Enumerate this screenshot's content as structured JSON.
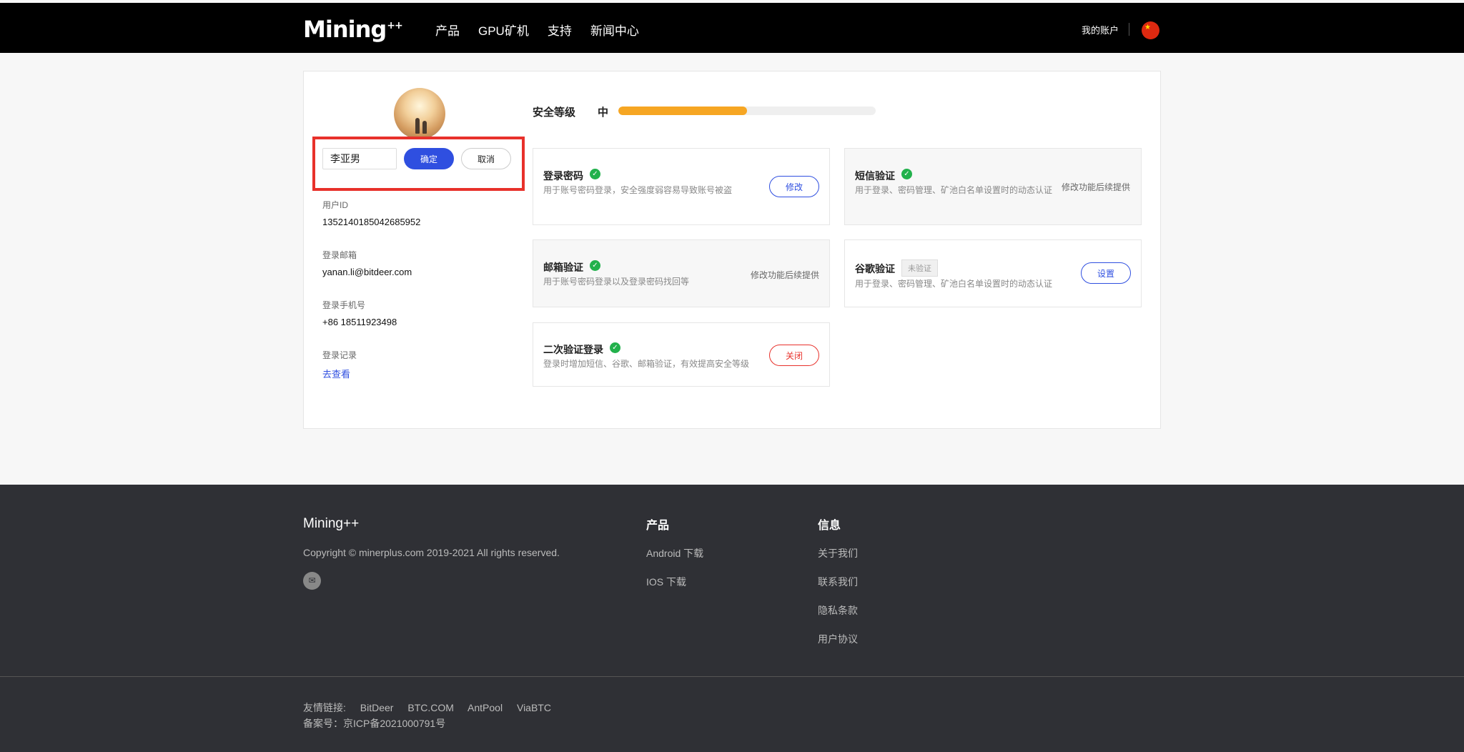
{
  "header": {
    "logo": "Mining",
    "logo_sup": "++",
    "nav": [
      "产品",
      "GPU矿机",
      "支持",
      "新闻中心"
    ],
    "account": "我的账户"
  },
  "profile": {
    "name_value": "李亚男",
    "confirm_label": "确定",
    "cancel_label": "取消",
    "user_id_label": "用户ID",
    "user_id": "1352140185042685952",
    "email_label": "登录邮箱",
    "email": "yanan.li@bitdeer.com",
    "phone_label": "登录手机号",
    "phone": "+86 18511923498",
    "log_label": "登录记录",
    "log_link": "去查看"
  },
  "security": {
    "title": "安全等级",
    "level": "中",
    "progress": 0.5,
    "panels": {
      "password": {
        "title": "登录密码",
        "desc": "用于账号密码登录，安全强度弱容易导致账号被盗",
        "button": "修改"
      },
      "sms": {
        "title": "短信验证",
        "desc": "用于登录、密码管理、矿池白名单设置时的动态认证",
        "note": "修改功能后续提供"
      },
      "email": {
        "title": "邮箱验证",
        "desc": "用于账号密码登录以及登录密码找回等",
        "note": "修改功能后续提供"
      },
      "google": {
        "title": "谷歌验证",
        "tag": "未验证",
        "desc": "用于登录、密码管理、矿池白名单设置时的动态认证",
        "button": "设置"
      },
      "twofa": {
        "title": "二次验证登录",
        "desc": "登录时增加短信、谷歌、邮箱验证，有效提高安全等级",
        "button": "关闭"
      }
    }
  },
  "footer": {
    "brand": "Mining++",
    "copyright": "Copyright © minerplus.com 2019-2021 All rights reserved.",
    "products_head": "产品",
    "products": [
      "Android 下载",
      "IOS 下载"
    ],
    "info_head": "信息",
    "info": [
      "关于我们",
      "联系我们",
      "隐私条款",
      "用户协议"
    ],
    "friends_label": "友情链接:",
    "friends": [
      "BitDeer",
      "BTC.COM",
      "AntPool",
      "ViaBTC"
    ],
    "icp": "备案号：京ICP备2021000791号"
  },
  "colors": {
    "accent": "#2f4fe0",
    "success": "#22b14c",
    "danger": "#e8312b",
    "progress": "#f6a623",
    "footer_bg": "#2f3035"
  }
}
